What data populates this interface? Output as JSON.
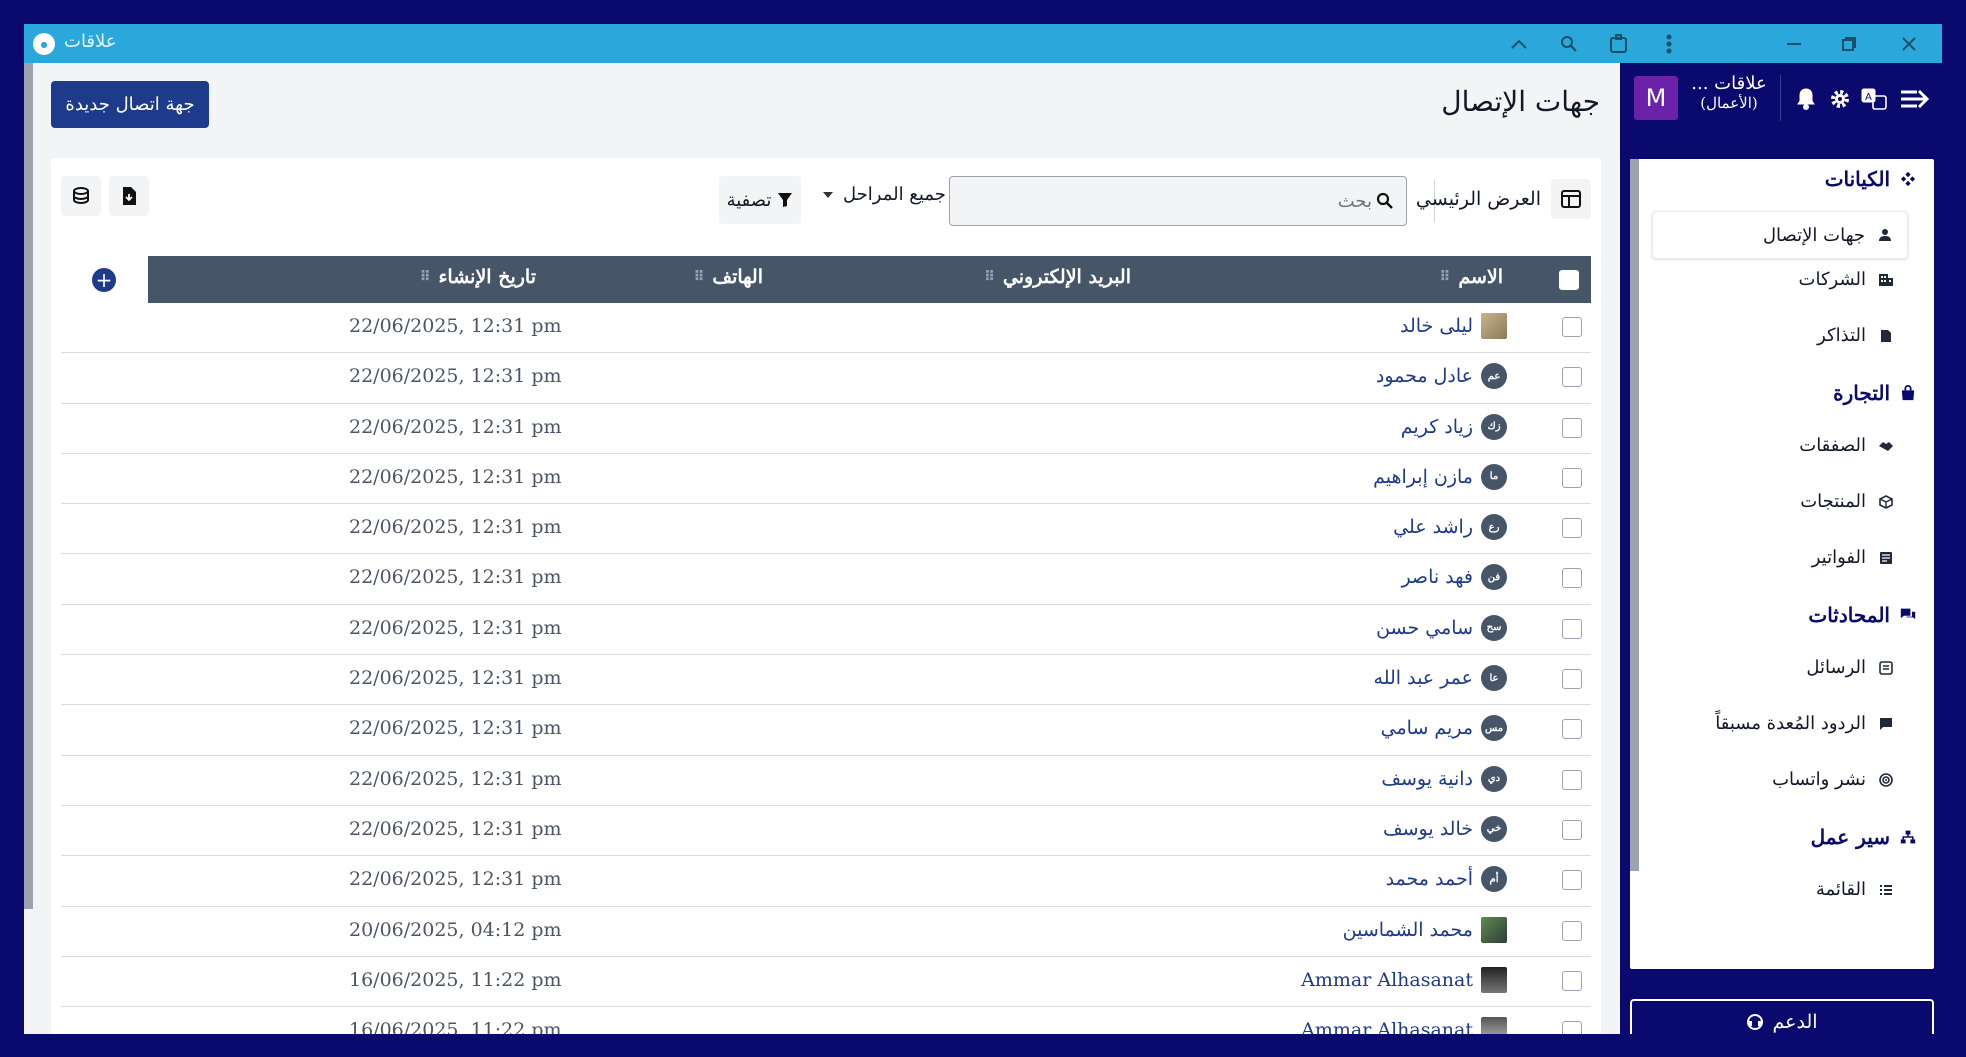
{
  "window": {
    "title": "علاقات",
    "logo_text": "علاقات"
  },
  "header": {
    "page_title": "جهات الإتصال",
    "new_button": "جهة اتصال جديدة"
  },
  "toolbar": {
    "view_label": "العرض الرئيسي",
    "search_placeholder": "بحث",
    "stages_label": "جميع المراحل",
    "filter_label": "تصفية"
  },
  "table": {
    "columns": [
      "الاسم",
      "البريد الإلكتروني",
      "الهاتف",
      "تاريخ الإنشاء"
    ],
    "rows": [
      {
        "name": "ليلى خالد",
        "initials": "",
        "avatar": "photo",
        "date": "22/06/2025, 12:31 pm"
      },
      {
        "name": "عادل محمود",
        "initials": "عم",
        "avatar": "initials",
        "date": "22/06/2025, 12:31 pm"
      },
      {
        "name": "زياد كريم",
        "initials": "زك",
        "avatar": "initials",
        "date": "22/06/2025, 12:31 pm"
      },
      {
        "name": "مازن إبراهيم",
        "initials": "ما",
        "avatar": "initials",
        "date": "22/06/2025, 12:31 pm"
      },
      {
        "name": "راشد علي",
        "initials": "رع",
        "avatar": "initials",
        "date": "22/06/2025, 12:31 pm"
      },
      {
        "name": "فهد ناصر",
        "initials": "فن",
        "avatar": "initials",
        "date": "22/06/2025, 12:31 pm"
      },
      {
        "name": "سامي حسن",
        "initials": "سح",
        "avatar": "initials",
        "date": "22/06/2025, 12:31 pm"
      },
      {
        "name": "عمر عبد الله",
        "initials": "عا",
        "avatar": "initials",
        "date": "22/06/2025, 12:31 pm"
      },
      {
        "name": "مريم سامي",
        "initials": "مس",
        "avatar": "initials",
        "date": "22/06/2025, 12:31 pm"
      },
      {
        "name": "دانية يوسف",
        "initials": "دي",
        "avatar": "initials",
        "date": "22/06/2025, 12:31 pm"
      },
      {
        "name": "خالد يوسف",
        "initials": "خي",
        "avatar": "initials",
        "date": "22/06/2025, 12:31 pm"
      },
      {
        "name": "أحمد محمد",
        "initials": "أم",
        "avatar": "initials",
        "date": "22/06/2025, 12:31 pm"
      },
      {
        "name": "محمد الشماسين",
        "initials": "",
        "avatar": "photo2",
        "date": "20/06/2025, 04:12 pm"
      },
      {
        "name": "Ammar Alhasanat",
        "initials": "",
        "avatar": "photo3",
        "date": "16/06/2025, 11:22 pm"
      },
      {
        "name": "Ammar Alhasanat",
        "initials": "",
        "avatar": "photo4",
        "date": "16/06/2025, 11:22 pm"
      }
    ]
  },
  "sidebar": {
    "avatar_letter": "M",
    "org_name": "علاقات ...",
    "org_sub": "(الأعمال)",
    "sections": [
      {
        "label": "الكيانات",
        "items": [
          "جهات الإتصال",
          "الشركات",
          "التذاكر"
        ]
      },
      {
        "label": "التجارة",
        "items": [
          "الصفقات",
          "المنتجات",
          "الفواتير"
        ]
      },
      {
        "label": "المحادثات",
        "items": [
          "الرسائل",
          "الردود المُعدة مسبقاً",
          "نشر واتساب"
        ]
      },
      {
        "label": "سير عمل",
        "items": [
          "القائمة"
        ]
      }
    ],
    "support": "الدعم"
  }
}
